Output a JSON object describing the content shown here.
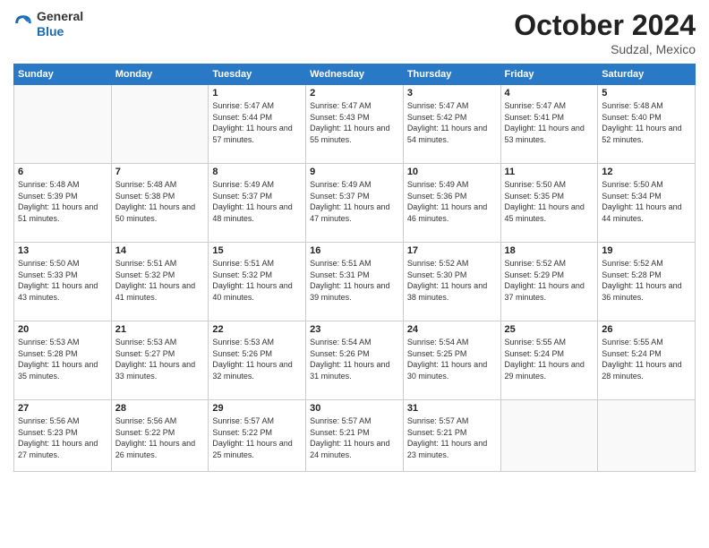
{
  "header": {
    "logo_general": "General",
    "logo_blue": "Blue",
    "month": "October 2024",
    "location": "Sudzal, Mexico"
  },
  "weekdays": [
    "Sunday",
    "Monday",
    "Tuesday",
    "Wednesday",
    "Thursday",
    "Friday",
    "Saturday"
  ],
  "weeks": [
    [
      {
        "day": "",
        "info": ""
      },
      {
        "day": "",
        "info": ""
      },
      {
        "day": "1",
        "info": "Sunrise: 5:47 AM\nSunset: 5:44 PM\nDaylight: 11 hours\nand 57 minutes."
      },
      {
        "day": "2",
        "info": "Sunrise: 5:47 AM\nSunset: 5:43 PM\nDaylight: 11 hours\nand 55 minutes."
      },
      {
        "day": "3",
        "info": "Sunrise: 5:47 AM\nSunset: 5:42 PM\nDaylight: 11 hours\nand 54 minutes."
      },
      {
        "day": "4",
        "info": "Sunrise: 5:47 AM\nSunset: 5:41 PM\nDaylight: 11 hours\nand 53 minutes."
      },
      {
        "day": "5",
        "info": "Sunrise: 5:48 AM\nSunset: 5:40 PM\nDaylight: 11 hours\nand 52 minutes."
      }
    ],
    [
      {
        "day": "6",
        "info": "Sunrise: 5:48 AM\nSunset: 5:39 PM\nDaylight: 11 hours\nand 51 minutes."
      },
      {
        "day": "7",
        "info": "Sunrise: 5:48 AM\nSunset: 5:38 PM\nDaylight: 11 hours\nand 50 minutes."
      },
      {
        "day": "8",
        "info": "Sunrise: 5:49 AM\nSunset: 5:37 PM\nDaylight: 11 hours\nand 48 minutes."
      },
      {
        "day": "9",
        "info": "Sunrise: 5:49 AM\nSunset: 5:37 PM\nDaylight: 11 hours\nand 47 minutes."
      },
      {
        "day": "10",
        "info": "Sunrise: 5:49 AM\nSunset: 5:36 PM\nDaylight: 11 hours\nand 46 minutes."
      },
      {
        "day": "11",
        "info": "Sunrise: 5:50 AM\nSunset: 5:35 PM\nDaylight: 11 hours\nand 45 minutes."
      },
      {
        "day": "12",
        "info": "Sunrise: 5:50 AM\nSunset: 5:34 PM\nDaylight: 11 hours\nand 44 minutes."
      }
    ],
    [
      {
        "day": "13",
        "info": "Sunrise: 5:50 AM\nSunset: 5:33 PM\nDaylight: 11 hours\nand 43 minutes."
      },
      {
        "day": "14",
        "info": "Sunrise: 5:51 AM\nSunset: 5:32 PM\nDaylight: 11 hours\nand 41 minutes."
      },
      {
        "day": "15",
        "info": "Sunrise: 5:51 AM\nSunset: 5:32 PM\nDaylight: 11 hours\nand 40 minutes."
      },
      {
        "day": "16",
        "info": "Sunrise: 5:51 AM\nSunset: 5:31 PM\nDaylight: 11 hours\nand 39 minutes."
      },
      {
        "day": "17",
        "info": "Sunrise: 5:52 AM\nSunset: 5:30 PM\nDaylight: 11 hours\nand 38 minutes."
      },
      {
        "day": "18",
        "info": "Sunrise: 5:52 AM\nSunset: 5:29 PM\nDaylight: 11 hours\nand 37 minutes."
      },
      {
        "day": "19",
        "info": "Sunrise: 5:52 AM\nSunset: 5:28 PM\nDaylight: 11 hours\nand 36 minutes."
      }
    ],
    [
      {
        "day": "20",
        "info": "Sunrise: 5:53 AM\nSunset: 5:28 PM\nDaylight: 11 hours\nand 35 minutes."
      },
      {
        "day": "21",
        "info": "Sunrise: 5:53 AM\nSunset: 5:27 PM\nDaylight: 11 hours\nand 33 minutes."
      },
      {
        "day": "22",
        "info": "Sunrise: 5:53 AM\nSunset: 5:26 PM\nDaylight: 11 hours\nand 32 minutes."
      },
      {
        "day": "23",
        "info": "Sunrise: 5:54 AM\nSunset: 5:26 PM\nDaylight: 11 hours\nand 31 minutes."
      },
      {
        "day": "24",
        "info": "Sunrise: 5:54 AM\nSunset: 5:25 PM\nDaylight: 11 hours\nand 30 minutes."
      },
      {
        "day": "25",
        "info": "Sunrise: 5:55 AM\nSunset: 5:24 PM\nDaylight: 11 hours\nand 29 minutes."
      },
      {
        "day": "26",
        "info": "Sunrise: 5:55 AM\nSunset: 5:24 PM\nDaylight: 11 hours\nand 28 minutes."
      }
    ],
    [
      {
        "day": "27",
        "info": "Sunrise: 5:56 AM\nSunset: 5:23 PM\nDaylight: 11 hours\nand 27 minutes."
      },
      {
        "day": "28",
        "info": "Sunrise: 5:56 AM\nSunset: 5:22 PM\nDaylight: 11 hours\nand 26 minutes."
      },
      {
        "day": "29",
        "info": "Sunrise: 5:57 AM\nSunset: 5:22 PM\nDaylight: 11 hours\nand 25 minutes."
      },
      {
        "day": "30",
        "info": "Sunrise: 5:57 AM\nSunset: 5:21 PM\nDaylight: 11 hours\nand 24 minutes."
      },
      {
        "day": "31",
        "info": "Sunrise: 5:57 AM\nSunset: 5:21 PM\nDaylight: 11 hours\nand 23 minutes."
      },
      {
        "day": "",
        "info": ""
      },
      {
        "day": "",
        "info": ""
      }
    ]
  ]
}
